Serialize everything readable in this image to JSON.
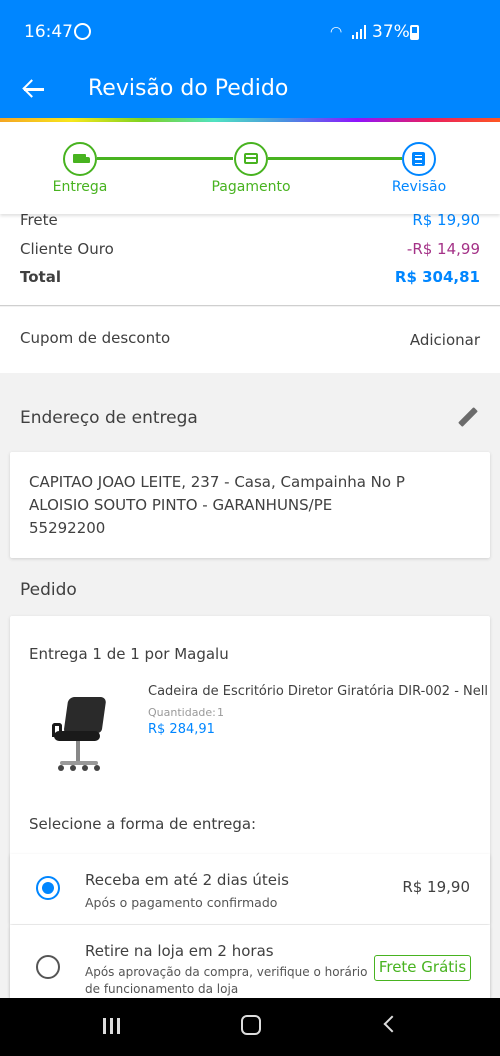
{
  "status_bar": {
    "time": "16:47",
    "battery": "37%"
  },
  "app_bar": {
    "title": "Revisão do Pedido"
  },
  "stepper": {
    "steps": [
      {
        "label": "Entrega",
        "icon": "truck-icon"
      },
      {
        "label": "Pagamento",
        "icon": "credit-card-icon"
      },
      {
        "label": "Revisão",
        "icon": "document-icon"
      }
    ]
  },
  "totals": {
    "frete_label": "Frete",
    "frete_value": "R$ 19,90",
    "cliente_ouro_label": "Cliente Ouro",
    "cliente_ouro_value": "-R$ 14,99",
    "total_label": "Total",
    "total_value": "R$ 304,81"
  },
  "coupon": {
    "label": "Cupom de desconto",
    "action": "Adicionar"
  },
  "address": {
    "heading": "Endereço de entrega",
    "line1": "CAPITAO JOAO LEITE, 237 - Casa, Campainha No P",
    "line2": "ALOISIO SOUTO PINTO - GARANHUNS/PE",
    "line3": "55292200"
  },
  "order": {
    "heading": "Pedido",
    "delivery_title": "Entrega 1 de 1 por Magalu",
    "product": {
      "name": "Cadeira de Escritório Diretor Giratória DIR-002 - Nell",
      "quantity_label": "Quantidade:",
      "quantity": "1",
      "price": "R$ 284,91"
    },
    "select_label": "Selecione a forma de entrega:",
    "options": [
      {
        "title": "Receba em até 2 dias úteis",
        "subtitle": "Após o pagamento confirmado",
        "price": "R$ 19,90",
        "selected": true
      },
      {
        "title": "Retire na loja em 2 horas",
        "subtitle_line1": "Após aprovação da compra, verifique o horário",
        "subtitle_line2": "de funcionamento da loja",
        "badge": "Frete Grátis",
        "selected": false
      }
    ]
  },
  "colors": {
    "primary": "#0086ff",
    "success": "#48b320",
    "discount": "#a43287"
  }
}
